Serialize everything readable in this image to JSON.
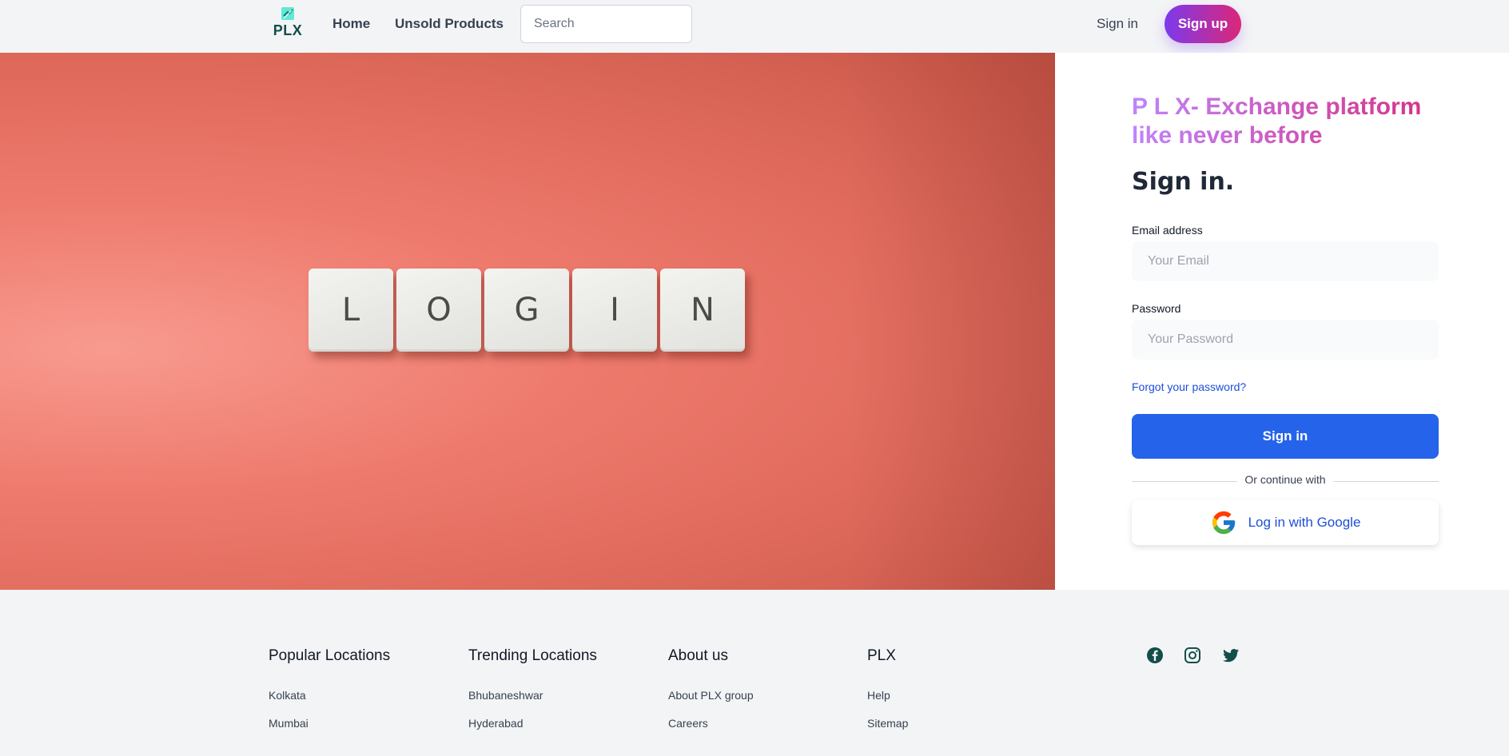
{
  "header": {
    "logo_text": "PLX",
    "nav": {
      "home": "Home",
      "unsold": "Unsold Products"
    },
    "search_placeholder": "Search",
    "sign_in": "Sign in",
    "sign_up": "Sign up"
  },
  "hero": {
    "tiles": [
      "L",
      "O",
      "G",
      "I",
      "N"
    ]
  },
  "login": {
    "tagline": "P L X- Exchange platform like never before",
    "title": "Sign in.",
    "email_label": "Email address",
    "email_placeholder": "Your Email",
    "password_label": "Password",
    "password_placeholder": "Your Password",
    "forgot": "Forgot your password?",
    "submit": "Sign in",
    "divider": "Or continue with",
    "google": "Log in with Google"
  },
  "footer": {
    "columns": [
      {
        "heading": "Popular Locations",
        "links": [
          "Kolkata",
          "Mumbai"
        ]
      },
      {
        "heading": "Trending Locations",
        "links": [
          "Bhubaneshwar",
          "Hyderabad"
        ]
      },
      {
        "heading": "About us",
        "links": [
          "About PLX group",
          "Careers"
        ]
      },
      {
        "heading": "PLX",
        "links": [
          "Help",
          "Sitemap"
        ]
      }
    ],
    "social": [
      "facebook-icon",
      "instagram-icon",
      "twitter-icon"
    ]
  },
  "colors": {
    "brand_teal": "#134e4a",
    "primary_blue": "#2563eb",
    "gradient_start": "#7c3aed",
    "gradient_end": "#db2777",
    "hero_coral": "#ee7a6d"
  }
}
